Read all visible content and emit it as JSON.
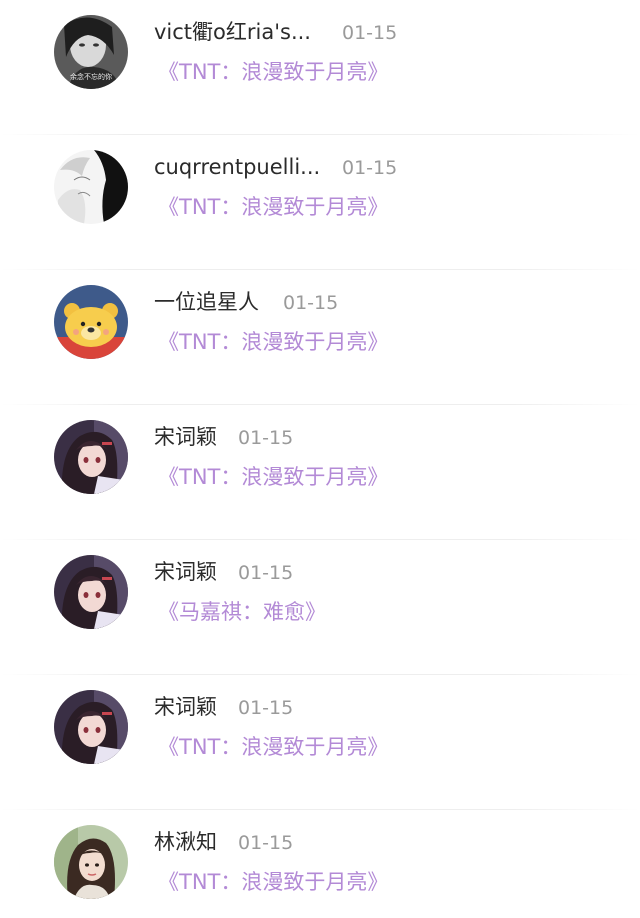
{
  "comments": [
    {
      "username": "vict衢o红ria's...",
      "date": "01-15",
      "work": "《TNT：浪漫致于月亮》",
      "avatar": "bw-girl-avatar"
    },
    {
      "username": "cuqrrentpuelli...",
      "date": "01-15",
      "work": "《TNT：浪漫致于月亮》",
      "avatar": "anime-sketch-avatar"
    },
    {
      "username": "一位追星人",
      "date": "01-15",
      "work": "《TNT：浪漫致于月亮》",
      "avatar": "bear-avatar"
    },
    {
      "username": "宋词颖",
      "date": "01-15",
      "work": "《TNT：浪漫致于月亮》",
      "avatar": "anime-girl-avatar"
    },
    {
      "username": "宋词颖",
      "date": "01-15",
      "work": "《马嘉祺：难愈》",
      "avatar": "anime-girl-avatar"
    },
    {
      "username": "宋词颖",
      "date": "01-15",
      "work": "《TNT：浪漫致于月亮》",
      "avatar": "anime-girl-avatar"
    },
    {
      "username": "林湫知",
      "date": "01-15",
      "work": "《TNT：浪漫致于月亮》",
      "avatar": "photo-girl-avatar"
    }
  ],
  "avatar_overlay_text": "余念不忘的你",
  "colors": {
    "link": "#b38ad6",
    "name": "#2b2b2b",
    "date": "#9a9a9a"
  }
}
